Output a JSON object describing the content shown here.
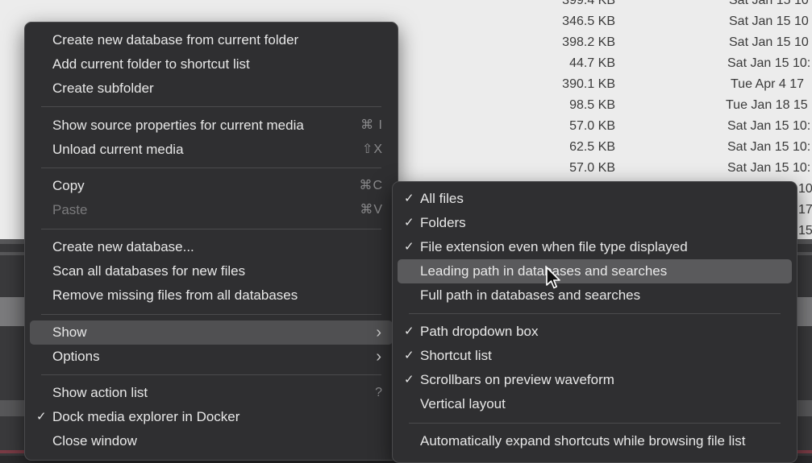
{
  "file_list": {
    "rows": [
      {
        "size": "399.4 KB",
        "date": "Sat Jan 15 10"
      },
      {
        "size": "346.5 KB",
        "date": "Sat Jan 15 10"
      },
      {
        "size": "398.2 KB",
        "date": "Sat Jan 15 10"
      },
      {
        "size": "44.7 KB",
        "date": "Sat Jan 15 10:"
      },
      {
        "size": "390.1 KB",
        "date": "Tue Apr  4 17"
      },
      {
        "size": "98.5 KB",
        "date": "Tue Jan 18 15"
      },
      {
        "size": "57.0 KB",
        "date": "Sat Jan 15 10:"
      },
      {
        "size": "62.5 KB",
        "date": "Sat Jan 15 10:"
      },
      {
        "size": "57.0 KB",
        "date": "Sat Jan 15 10:"
      },
      {
        "size": "",
        "date": "10:"
      },
      {
        "size": "",
        "date": "17"
      },
      {
        "size": "",
        "date": "15"
      }
    ]
  },
  "main_menu": {
    "items": [
      {
        "label": "Create new database from current folder",
        "shortcut": "",
        "checked": false
      },
      {
        "label": "Add current folder to shortcut list",
        "shortcut": "",
        "checked": false
      },
      {
        "label": "Create subfolder",
        "shortcut": "",
        "checked": false
      },
      {
        "label": "Show source properties for current media",
        "shortcut": "⌘ I",
        "checked": false
      },
      {
        "label": "Unload current media",
        "shortcut": "⇧X",
        "checked": false
      },
      {
        "label": "Copy",
        "shortcut": "⌘C",
        "checked": false
      },
      {
        "label": "Paste",
        "shortcut": "⌘V",
        "checked": false,
        "disabled": true
      },
      {
        "label": "Create new database...",
        "shortcut": "",
        "checked": false
      },
      {
        "label": "Scan all databases for new files",
        "shortcut": "",
        "checked": false
      },
      {
        "label": "Remove missing files from all databases",
        "shortcut": "",
        "checked": false
      },
      {
        "label": "Show",
        "shortcut": "",
        "checked": false,
        "submenu": true,
        "active": true
      },
      {
        "label": "Options",
        "shortcut": "",
        "checked": false,
        "submenu": true
      },
      {
        "label": "Show action list",
        "shortcut": "?",
        "checked": false
      },
      {
        "label": "Dock media explorer in Docker",
        "shortcut": "",
        "checked": true
      },
      {
        "label": "Close window",
        "shortcut": "",
        "checked": false
      }
    ]
  },
  "show_submenu": {
    "items": [
      {
        "label": "All files",
        "checked": true
      },
      {
        "label": "Folders",
        "checked": true
      },
      {
        "label": "File extension even when file type displayed",
        "checked": true
      },
      {
        "label": "Leading path in databases and searches",
        "checked": false,
        "hover": true
      },
      {
        "label": "Full path in databases and searches",
        "checked": false
      },
      {
        "label": "Path dropdown box",
        "checked": true
      },
      {
        "label": "Shortcut list",
        "checked": true
      },
      {
        "label": "Scrollbars on preview waveform",
        "checked": true
      },
      {
        "label": "Vertical layout",
        "checked": false
      },
      {
        "label": "Automatically expand shortcuts while browsing file list",
        "checked": false
      }
    ]
  },
  "glyphs": {
    "check": "✓",
    "chevron": "›"
  },
  "colors": {
    "menu_bg": "#2f2f31",
    "highlight": "#5a5a5c",
    "text": "#e8e8e8",
    "disabled": "#7a7a7c"
  }
}
